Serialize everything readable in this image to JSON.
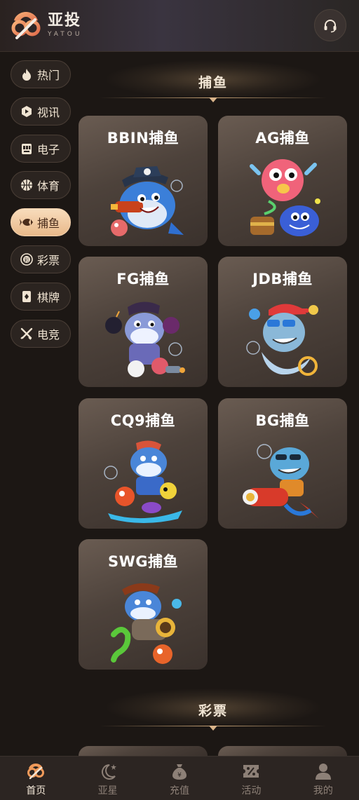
{
  "brand": {
    "name_cn": "亚投",
    "name_en": "YATOU"
  },
  "sidebar": {
    "items": [
      {
        "label": "热门",
        "icon": "flame-icon",
        "active": false
      },
      {
        "label": "视讯",
        "icon": "play-icon",
        "active": false
      },
      {
        "label": "电子",
        "icon": "slot-machine-icon",
        "active": false
      },
      {
        "label": "体育",
        "icon": "basketball-icon",
        "active": false
      },
      {
        "label": "捕鱼",
        "icon": "fish-icon",
        "active": true
      },
      {
        "label": "彩票",
        "icon": "lottery-icon",
        "active": false
      },
      {
        "label": "棋牌",
        "icon": "cards-icon",
        "active": false
      },
      {
        "label": "电竞",
        "icon": "swords-icon",
        "active": false
      }
    ]
  },
  "sections": {
    "fishing": {
      "title": "捕鱼",
      "cards": [
        {
          "label": "BBIN捕鱼",
          "art": "shark-pirate-cannon"
        },
        {
          "label": "AG捕鱼",
          "art": "pufferfish-and-fish"
        },
        {
          "label": "FG捕鱼",
          "art": "shark-pirate-bombs"
        },
        {
          "label": "JDB捕鱼",
          "art": "shark-sunglasses-cap"
        },
        {
          "label": "CQ9捕鱼",
          "art": "shark-bandana-fishes"
        },
        {
          "label": "BG捕鱼",
          "art": "shark-sunglasses-cannon"
        },
        {
          "label": "SWG捕鱼",
          "art": "shark-pirate-seahorse"
        }
      ]
    },
    "lottery": {
      "title": "彩票"
    }
  },
  "bottom_nav": [
    {
      "label": "首页",
      "icon": "home-logo-icon",
      "active": true
    },
    {
      "label": "亚星",
      "icon": "moon-star-icon",
      "active": false
    },
    {
      "label": "充值",
      "icon": "money-bag-icon",
      "active": false
    },
    {
      "label": "活动",
      "icon": "percent-ticket-icon",
      "active": false
    },
    {
      "label": "我的",
      "icon": "user-icon",
      "active": false
    }
  ],
  "colors": {
    "accent": "#efc49a",
    "background": "#1c1714",
    "card": "#4d423b"
  }
}
